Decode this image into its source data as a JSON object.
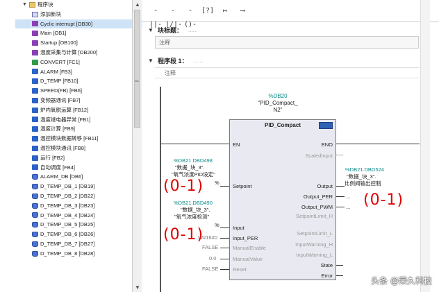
{
  "tree": {
    "root_label": "程序块",
    "items": [
      {
        "label": "添加新块",
        "icon": "add"
      },
      {
        "label": "Cyclic interrupt [OB30]",
        "icon": "ob",
        "selected": true
      },
      {
        "label": "Main [OB1]",
        "icon": "ob"
      },
      {
        "label": "Startup [OB100]",
        "icon": "ob"
      },
      {
        "label": "温度采集与计算 [OB200]",
        "icon": "ob"
      },
      {
        "label": "CONVERT [FC1]",
        "icon": "fc"
      },
      {
        "label": "ALARM [FB3]",
        "icon": "fb"
      },
      {
        "label": "D_TEMP [FB10]",
        "icon": "fb"
      },
      {
        "label": "SPEED(FB) [FB6]",
        "icon": "fb"
      },
      {
        "label": "变频器通讯 [FB7]",
        "icon": "fb"
      },
      {
        "label": "炉内氧脱运算 [FB12]",
        "icon": "fb"
      },
      {
        "label": "温度继电器异常 [FB1]",
        "icon": "fb"
      },
      {
        "label": "温度计算 [FB9]",
        "icon": "fb"
      },
      {
        "label": "温控模块数据转移 [FB11]",
        "icon": "fb"
      },
      {
        "label": "温控模块通讯 [FB8]",
        "icon": "fb"
      },
      {
        "label": "运行 [FB2]",
        "icon": "fb"
      },
      {
        "label": "自动调度 [FB4]",
        "icon": "fb"
      },
      {
        "label": "ALARM_DB [DB6]",
        "icon": "db"
      },
      {
        "label": "D_TEMP_DB_1 [DB19]",
        "icon": "db"
      },
      {
        "label": "D_TEMP_DB_2 [DB22]",
        "icon": "db"
      },
      {
        "label": "D_TEMP_DB_3 [DB23]",
        "icon": "db"
      },
      {
        "label": "D_TEMP_DB_4 [DB24]",
        "icon": "db"
      },
      {
        "label": "D_TEMP_DB_5 [DB25]",
        "icon": "db"
      },
      {
        "label": "D_TEMP_DB_6 [DB26]",
        "icon": "db"
      },
      {
        "label": "D_TEMP_DB_7 [DB27]",
        "icon": "db"
      },
      {
        "label": "D_TEMP_DB_8 [DB28]",
        "icon": "db"
      }
    ]
  },
  "toolbar": {
    "buttons": [
      "-||-",
      "-|/|-",
      "-()-",
      "[?]",
      "↦",
      "⟶"
    ]
  },
  "block": {
    "title_label": "块标题：",
    "title_dots": "......",
    "comment": "注释"
  },
  "network": {
    "title_label": "程序段 1：",
    "title_dots": "......",
    "comment": "注释"
  },
  "fb": {
    "instance_tag": "%DB20",
    "instance_name_line1": "\"PID_Compact_",
    "instance_name_line2": "N2\"",
    "type_name": "PID_Compact",
    "pins_in": {
      "en": "EN",
      "setpoint": "Setpoint",
      "input": "Input",
      "input_per": "Input_PER",
      "manual_enable": "ManualEnable",
      "manual_value": "ManualValue",
      "reset": "Reset"
    },
    "pins_out": {
      "eno": "ENO",
      "scaled_input": "ScaledInput",
      "output": "Output",
      "output_per": "Output_PER",
      "output_pwm": "Output_PWM",
      "setpoint_limit_h": "SetpointLimit_H",
      "setpoint_limit_l": "SetpointLimit_L",
      "input_warning_h": "InputWarning_H",
      "input_warning_l": "InputWarning_L",
      "state": "State",
      "error": "Error"
    }
  },
  "operands": {
    "setpoint_tag": "%DB21.DBD498",
    "setpoint_name1": "\"数据_块_3\".",
    "setpoint_name2": "\"氧气浓度PID设定\"",
    "setpoint_percent": "%",
    "input_tag": "%DB21.DBD490",
    "input_name1": "\"数据_块_3\".",
    "input_name2": "\"氧气浓度检测\"",
    "input_percent": "%",
    "input_per_value": "W#16#0",
    "manual_enable_value": "FALSE",
    "manual_value_value": "0.0",
    "reset_value": "FALSE",
    "output_tag": "%DB21.DBD524",
    "output_name1": "\"数据_块_3\".",
    "output_name2": "比例阀输出控制",
    "output_per_value": "...",
    "output_pwm_value": "..."
  },
  "annotations": {
    "left_range_1": "(0-1)",
    "left_range_2": "(0-1)",
    "right_range": "(0-1)"
  },
  "watermark": "头条 @荣久科技"
}
